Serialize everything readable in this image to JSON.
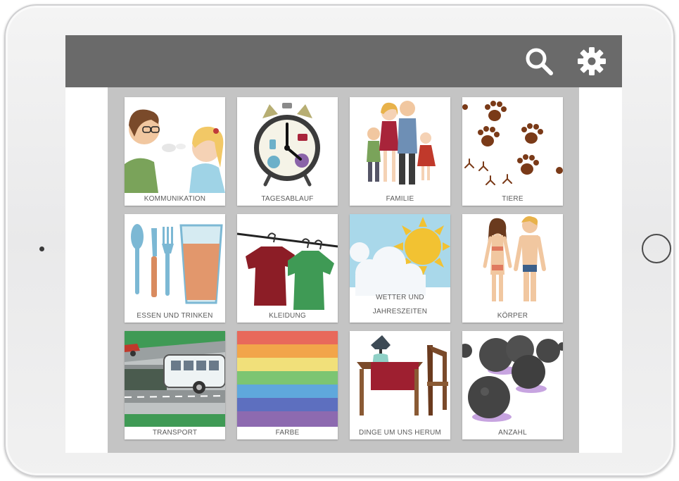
{
  "header": {
    "search_icon": "search-icon",
    "settings_icon": "gear-icon"
  },
  "categories": [
    {
      "label": "KOMMUNIKATION"
    },
    {
      "label": "TAGESABLAUF"
    },
    {
      "label": "FAMILIE"
    },
    {
      "label": "TIERE"
    },
    {
      "label": "ESSEN UND TRINKEN"
    },
    {
      "label": "KLEIDUNG"
    },
    {
      "label_line1": "WETTER UND",
      "label_line2": "JAHRESZEITEN"
    },
    {
      "label": "KÖRPER"
    },
    {
      "label": "TRANSPORT"
    },
    {
      "label": "FARBE"
    },
    {
      "label": "DINGE UM UNS HERUM"
    },
    {
      "label": "ANZAHL"
    }
  ],
  "colors": {
    "topbar": "#6a6a6a",
    "grid_background": "#c4c4c4",
    "label_text": "#5a5a5a"
  }
}
